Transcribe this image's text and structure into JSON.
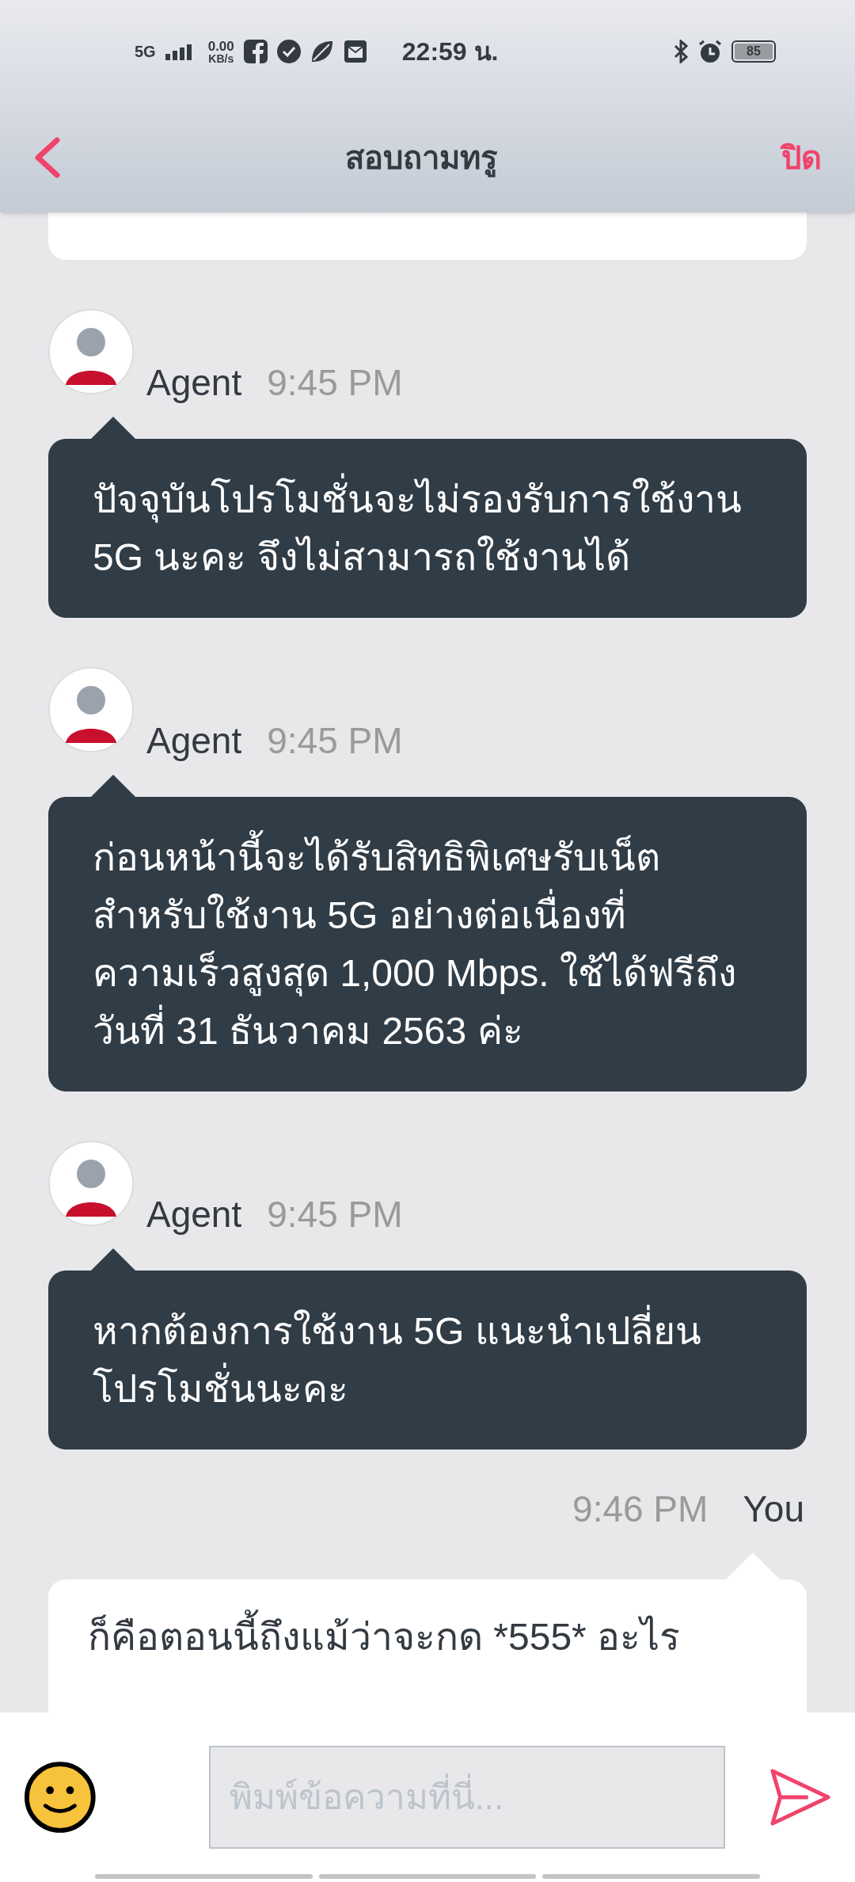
{
  "status_bar": {
    "network": "5G",
    "speed": "0.00",
    "speed_unit": "KB/s",
    "time": "22:59 น.",
    "battery": "85"
  },
  "header": {
    "title": "สอบถามทรู",
    "close": "ปิด"
  },
  "messages": [
    {
      "kind": "agent",
      "sender": "Agent",
      "time": "9:45 PM",
      "text": "ปัจจุบันโปรโมชั่นจะไม่รองรับการใช้งาน 5G นะคะ จึงไม่สามารถใช้งานได้"
    },
    {
      "kind": "agent",
      "sender": "Agent",
      "time": "9:45 PM",
      "text": "ก่อนหน้านี้จะได้รับสิทธิพิเศษรับเน็ตสำหรับใช้งาน 5G อย่างต่อเนื่องที่ความเร็วสูงสุด 1,000 Mbps. ใช้ได้ฟรีถึงวันที่ 31 ธันวาคม 2563 ค่ะ"
    },
    {
      "kind": "agent",
      "sender": "Agent",
      "time": "9:45 PM",
      "text": "หากต้องการใช้งาน 5G แนะนำเปลี่ยนโปรโมชั่นนะคะ"
    },
    {
      "kind": "user",
      "sender": "You",
      "time": "9:46 PM",
      "text": "ก็คือตอนนี้ถึงแม้ว่าจะกด *555* อะไร"
    }
  ],
  "composer": {
    "placeholder": "พิมพ์ข้อความที่นี่..."
  }
}
